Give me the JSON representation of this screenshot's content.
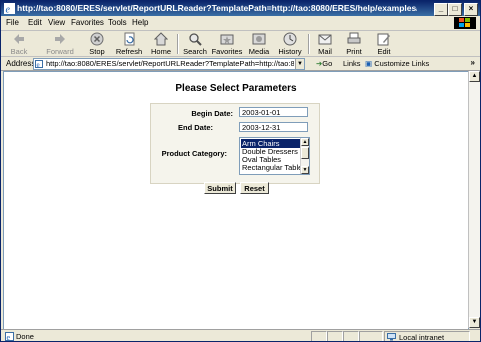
{
  "window": {
    "title": "http://tao:8080/ERES/servlet/ReportURLReader?TemplatePath=http://tao:8080/ERES/help/examples/UR - Microsoft Inte...",
    "min": "_",
    "max": "□",
    "close": "×"
  },
  "menu": [
    "File",
    "Edit",
    "View",
    "Favorites",
    "Tools",
    "Help"
  ],
  "toolbar": {
    "back": "Back",
    "forward": "Forward",
    "stop": "Stop",
    "refresh": "Refresh",
    "home": "Home",
    "search": "Search",
    "favorites": "Favorites",
    "media": "Media",
    "history": "History",
    "mail": "Mail",
    "print": "Print",
    "edit": "Edit"
  },
  "address": {
    "label": "Address",
    "url": "http://tao:8080/ERES/servlet/ReportURLReader?TemplatePath=http://tao:8080/ERES/h",
    "go": "Go",
    "links": "Links",
    "custom_links": "Customize Links",
    "more": "»"
  },
  "page": {
    "title": "Please Select Parameters",
    "begin_label": "Begin Date:",
    "begin_value": "2003-01-01",
    "end_label": "End Date:",
    "end_value": "2003-12-31",
    "category_label": "Product Category:",
    "options": [
      "Arm Chairs",
      "Double Dressers",
      "Oval Tables",
      "Rectangular Tables"
    ],
    "selected_option": "Arm Chairs",
    "submit": "Submit",
    "reset": "Reset"
  },
  "status": {
    "text": "Done",
    "zone": "Local intranet"
  },
  "colors": {
    "titlebar": "#0a246a",
    "selection": "#0a246a",
    "chrome": "#ece9d8"
  }
}
